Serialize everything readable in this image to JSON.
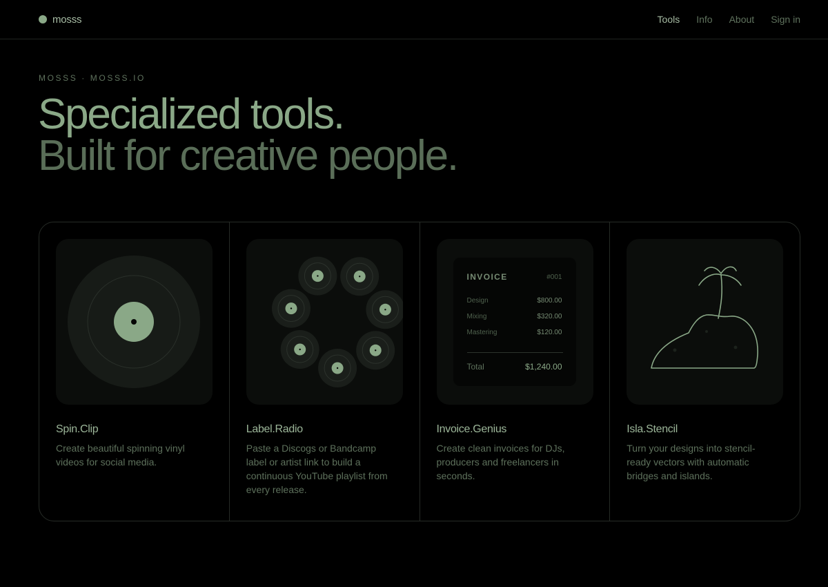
{
  "brand": {
    "name": "mosss"
  },
  "nav": {
    "links": [
      {
        "label": "Tools",
        "active": true
      },
      {
        "label": "Info",
        "active": false
      },
      {
        "label": "About",
        "active": false
      },
      {
        "label": "Sign in",
        "active": false
      }
    ]
  },
  "hero": {
    "eyebrow": "MOSSS · MOSSS.IO",
    "line1": "Specialized tools.",
    "line2": "Built for creative people."
  },
  "cards": [
    {
      "title": "Spin.Clip",
      "desc": "Create beautiful spinning vinyl videos for social media.",
      "icon": "vinyl-record-icon"
    },
    {
      "title": "Label.Radio",
      "desc": "Paste a Discogs or Bandcamp label or artist link to build a continuous YouTube playlist from every release.",
      "icon": "record-ring-icon"
    },
    {
      "title": "Invoice.Genius",
      "desc": "Create clean invoices for DJs, producers and freelancers in seconds.",
      "icon": "invoice-icon"
    },
    {
      "title": "Isla.Stencil",
      "desc": "Turn your designs into stencil-ready vectors with automatic bridges and islands.",
      "icon": "island-palm-icon"
    }
  ],
  "invoice": {
    "title": "INVOICE",
    "number": "#001",
    "items": [
      {
        "label": "Design",
        "amount": "$800.00"
      },
      {
        "label": "Mixing",
        "amount": "$320.00"
      },
      {
        "label": "Mastering",
        "amount": "$120.00"
      }
    ],
    "total_label": "Total",
    "total_amount": "$1,240.00"
  },
  "colors": {
    "accent": "#8aa887",
    "muted": "#5d705b",
    "background": "#000000",
    "surface": "#0b0d0b"
  }
}
